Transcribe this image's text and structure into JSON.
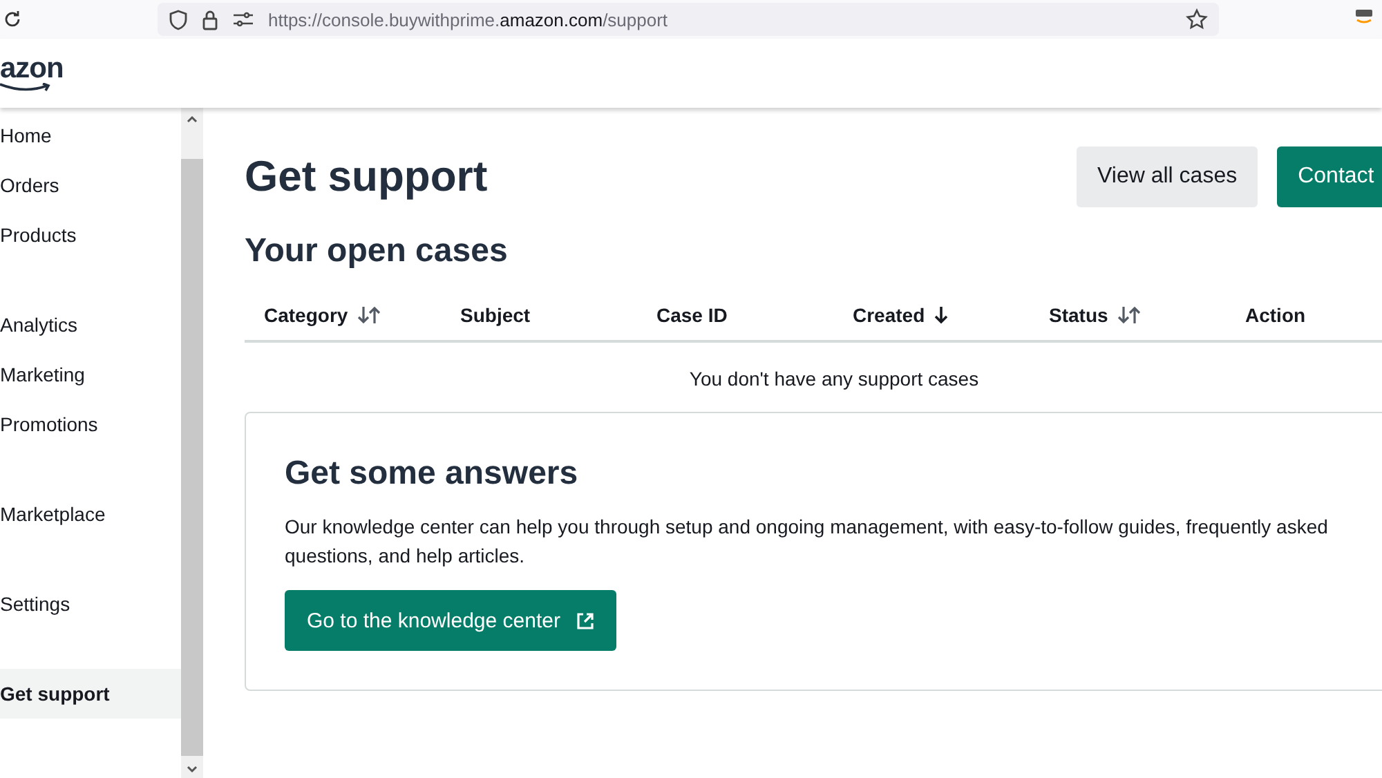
{
  "browser": {
    "url": "https://console.buywithprime.**amazon.com**/support"
  },
  "header": {
    "logo": "azon"
  },
  "sidebar": {
    "groups": [
      {
        "items": [
          {
            "label": "Home",
            "selected": false
          },
          {
            "label": "Orders",
            "selected": false
          },
          {
            "label": "Products",
            "selected": false
          }
        ]
      },
      {
        "items": [
          {
            "label": "Analytics",
            "selected": false
          },
          {
            "label": "Marketing",
            "selected": false
          },
          {
            "label": "Promotions",
            "selected": false
          }
        ]
      },
      {
        "items": [
          {
            "label": "Marketplace",
            "selected": false
          }
        ]
      },
      {
        "items": [
          {
            "label": "Settings",
            "selected": false
          }
        ]
      },
      {
        "items": [
          {
            "label": "Get support",
            "selected": true
          }
        ]
      }
    ]
  },
  "page": {
    "title": "Get support",
    "buttons": [
      {
        "label": "View all cases",
        "kind": "secondary"
      },
      {
        "label": "Contact",
        "kind": "primary"
      }
    ]
  },
  "cases": {
    "title": "Your open cases",
    "columns": [
      {
        "label": "Category",
        "sortable": true,
        "sorted": false
      },
      {
        "label": "Subject",
        "sortable": false,
        "sorted": false
      },
      {
        "label": "Case ID",
        "sortable": false,
        "sorted": false
      },
      {
        "label": "Created",
        "sortable": true,
        "sorted": true
      },
      {
        "label": "Status",
        "sortable": true,
        "sorted": false
      },
      {
        "label": "Action",
        "sortable": false,
        "sorted": false
      }
    ],
    "empty": "You don't have any support cases"
  },
  "answers": {
    "title": "Get some answers",
    "text": "Our knowledge center can help you through setup and ongoing management, with easy-to-follow guides, frequently asked questions, and help articles.",
    "button": "Go to the knowledge center"
  }
}
